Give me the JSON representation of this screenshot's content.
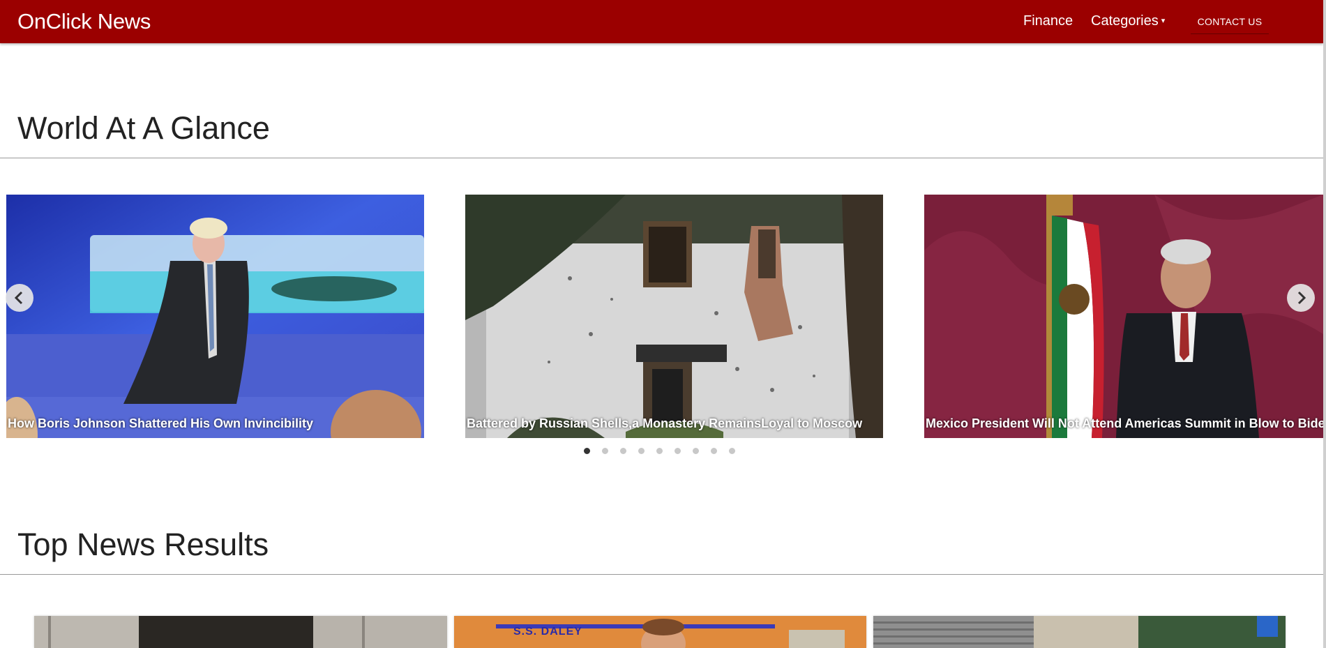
{
  "nav": {
    "brand": "OnClick News",
    "finance": "Finance",
    "categories": "Categories",
    "caret": "▾",
    "contact": "CONTACT US"
  },
  "sections": {
    "world": "World At A Glance",
    "top": "Top News Results"
  },
  "carousel": {
    "slides": [
      {
        "caption": "How Boris Johnson Shattered His Own Invincibility"
      },
      {
        "caption": "Battered by Russian Shells,a Monastery RemainsLoyal to Moscow"
      },
      {
        "caption": "Mexico President Will Not Attend Americas Summit in Blow to Biden"
      }
    ],
    "dot_count": 9,
    "active_dot": 1
  },
  "cards": {
    "sign_text": "S.S. DALEY"
  },
  "colors": {
    "navbar": "#9b0000",
    "text": "#222222",
    "dot_active": "#333333",
    "dot_inactive": "#c8c8c8"
  }
}
